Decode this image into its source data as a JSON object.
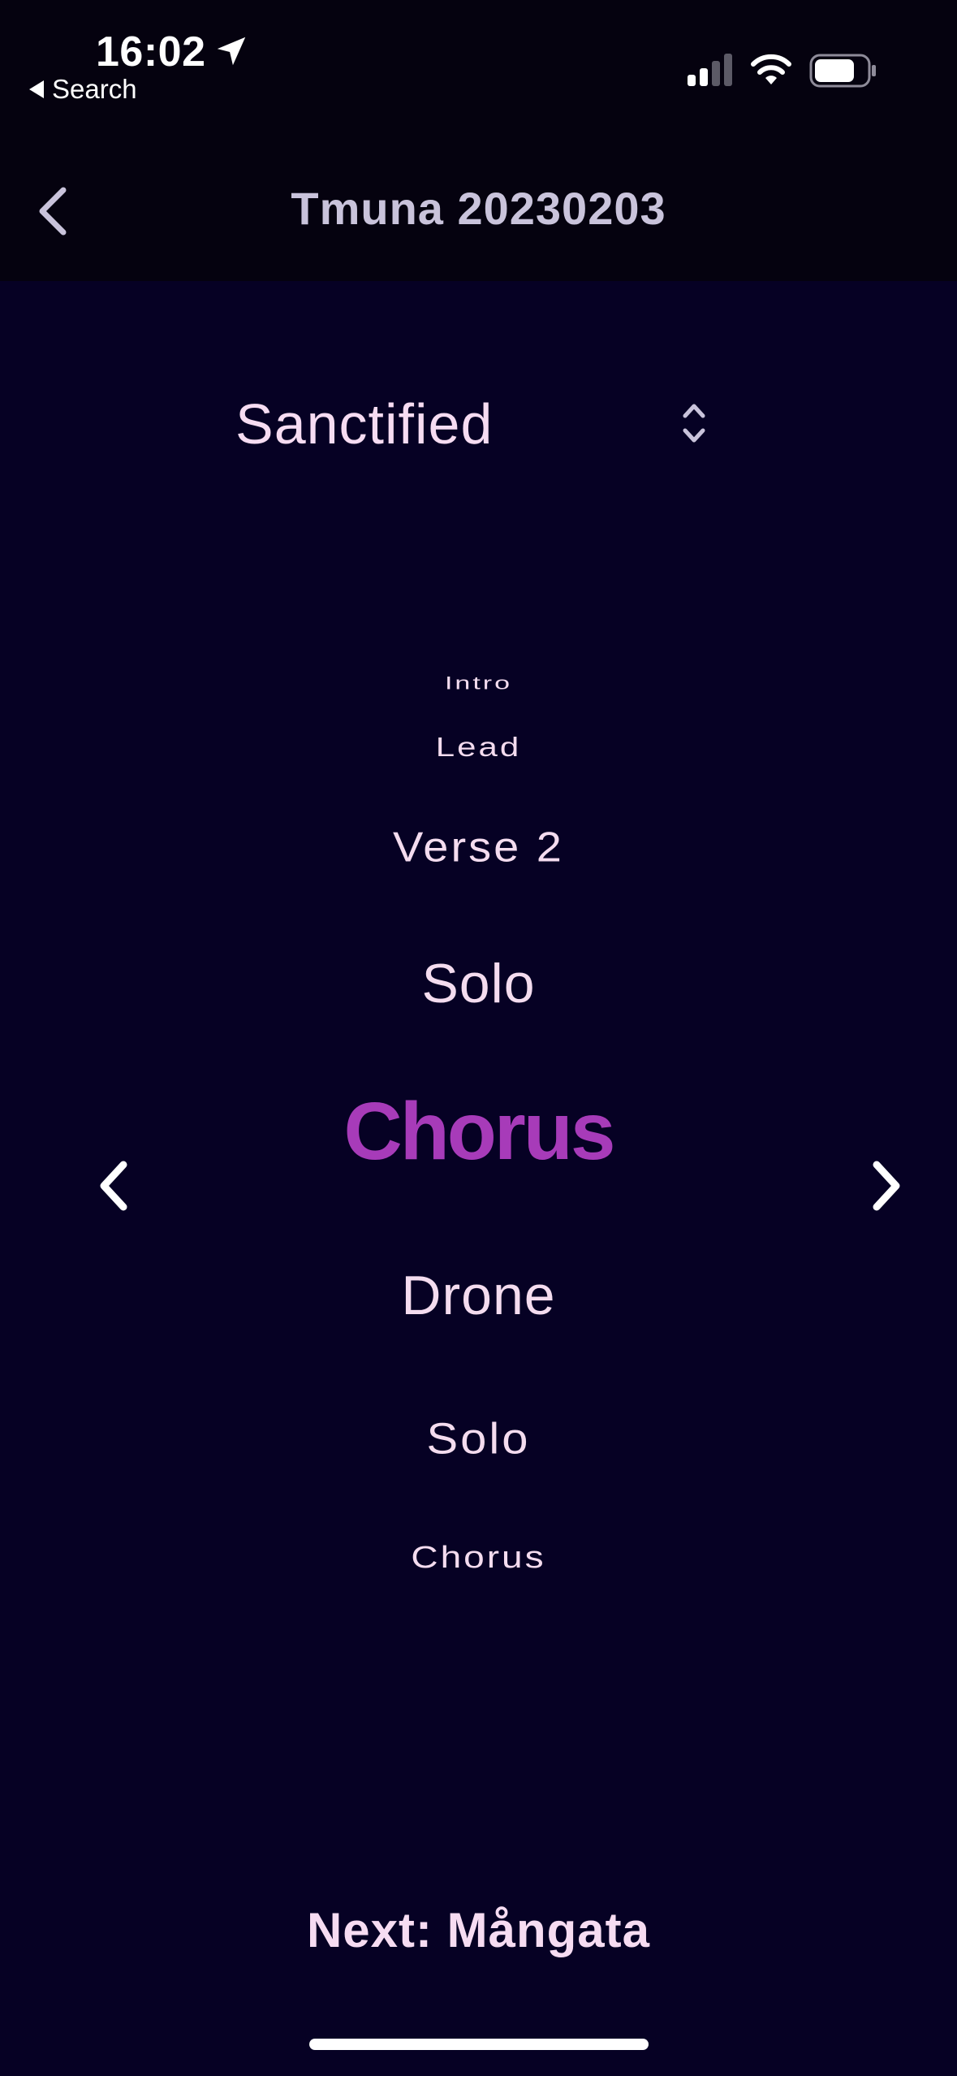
{
  "status_bar": {
    "time": "16:02",
    "back_app_label": "Search",
    "icons": [
      "location-arrow-icon",
      "cellular-signal-icon",
      "wifi-icon",
      "battery-icon"
    ]
  },
  "nav": {
    "title": "Tmuna 20230203",
    "back_icon": "chevron-left-icon"
  },
  "song_selector": {
    "value": "Sanctified",
    "icon": "up-down-chevrons-icon"
  },
  "sections": [
    "Intro",
    "Lead",
    "Verse 2",
    "Solo",
    "Chorus",
    "Drone",
    "Solo",
    "Chorus"
  ],
  "current_section_index": 4,
  "controls": {
    "prev_icon": "chevron-left-icon",
    "next_icon": "chevron-right-icon"
  },
  "next_song": "Next: Mångata",
  "colors": {
    "background": "#060124",
    "header": "#05020f",
    "text": "#f6dcf2",
    "title": "#c9c3db",
    "accent": "#a73bb9"
  }
}
